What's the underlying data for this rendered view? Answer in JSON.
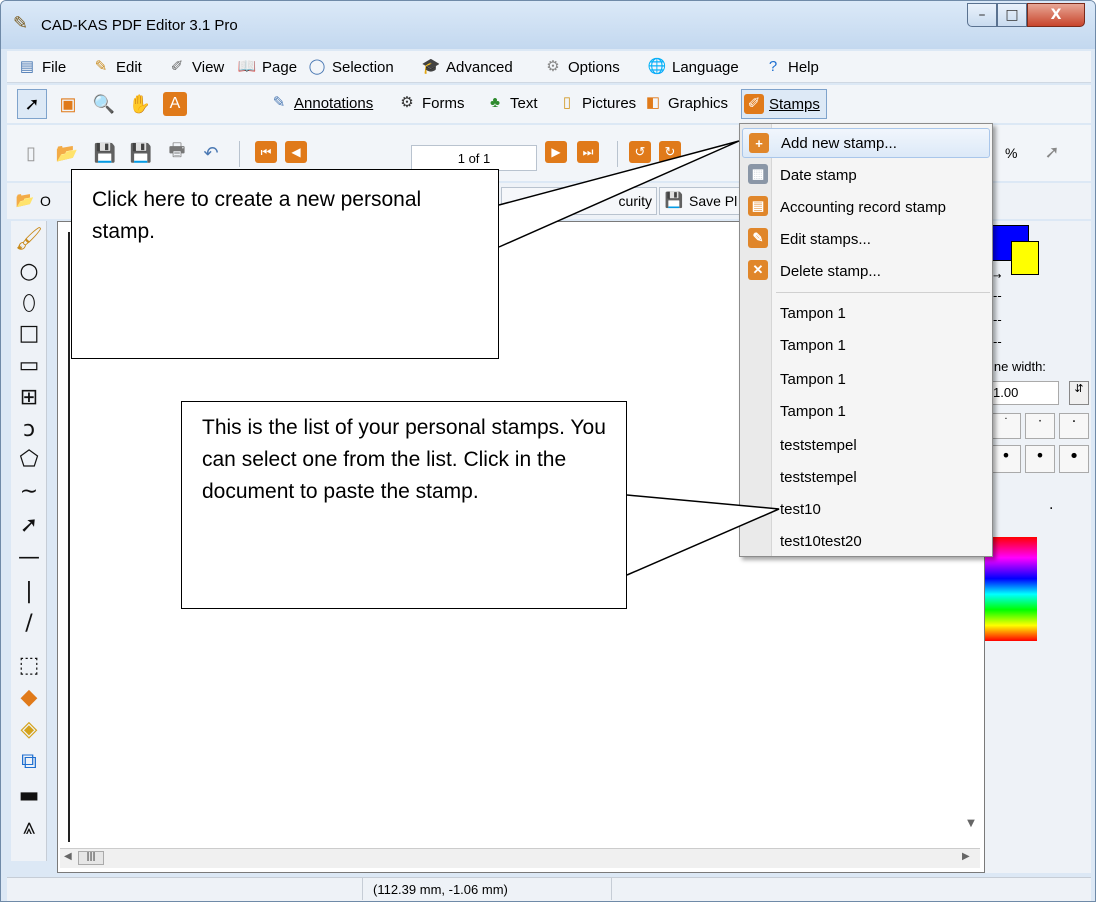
{
  "window": {
    "title": "CAD-KAS PDF Editor 3.1 Pro",
    "minimize": "–",
    "maximize": "□",
    "close": "X"
  },
  "menubar": {
    "items": [
      {
        "label": "File",
        "icon": "file-icon"
      },
      {
        "label": "Edit",
        "icon": "edit-icon"
      },
      {
        "label": "View",
        "icon": "view-icon"
      },
      {
        "label": "Page",
        "icon": "page-icon"
      },
      {
        "label": "Selection",
        "icon": "selection-icon"
      },
      {
        "label": "Advanced",
        "icon": "advanced-icon"
      },
      {
        "label": "Options",
        "icon": "options-icon"
      },
      {
        "label": "Language",
        "icon": "language-icon"
      },
      {
        "label": "Help",
        "icon": "help-icon"
      }
    ]
  },
  "toolbar1": {
    "tabs": [
      {
        "label": "Annotations",
        "icon": "annotations-icon"
      },
      {
        "label": "Forms",
        "icon": "forms-icon"
      },
      {
        "label": "Text",
        "icon": "text-icon"
      },
      {
        "label": "Pictures",
        "icon": "pictures-icon"
      },
      {
        "label": "Graphics",
        "icon": "graphics-icon"
      },
      {
        "label": "Stamps",
        "icon": "stamps-icon"
      }
    ]
  },
  "toolbar2": {
    "page_indicator": "1 of 1",
    "zoom_unit": "%"
  },
  "toolbar3": {
    "open_label": "O",
    "security_label": "curity",
    "save_label": "Save Pl"
  },
  "dropdown": {
    "items": [
      {
        "label": "Add new stamp...",
        "icon": "add-stamp-icon",
        "color": "#e0862a"
      },
      {
        "label": "Date stamp",
        "icon": "calendar-icon",
        "color": "#8a96a6"
      },
      {
        "label": "Accounting record stamp",
        "icon": "record-icon",
        "color": "#e0862a"
      },
      {
        "label": "Edit stamps...",
        "icon": "edit-stamp-icon",
        "color": "#e0862a"
      },
      {
        "label": "Delete stamp...",
        "icon": "delete-stamp-icon",
        "color": "#e0862a"
      }
    ],
    "stamps": [
      "Tampon 1",
      "Tampon 1",
      "Tampon 1",
      "Tampon 1",
      "teststempel",
      "teststempel",
      "test10",
      "test10test20"
    ]
  },
  "rightpanel": {
    "line_width_label": "ine width:",
    "line_width_value": "1.00",
    "dash": "--",
    "dot": "."
  },
  "statusbar": {
    "coords": "(112.39 mm, -1.06 mm)"
  },
  "callouts": {
    "top": "Click here to create a new personal stamp.",
    "bottom": "This is the list of your personal stamps. You can select one from the list. Click in the document to paste the stamp."
  },
  "colors": {
    "primary_color": "#0000ff",
    "secondary_color": "#ffff00"
  }
}
